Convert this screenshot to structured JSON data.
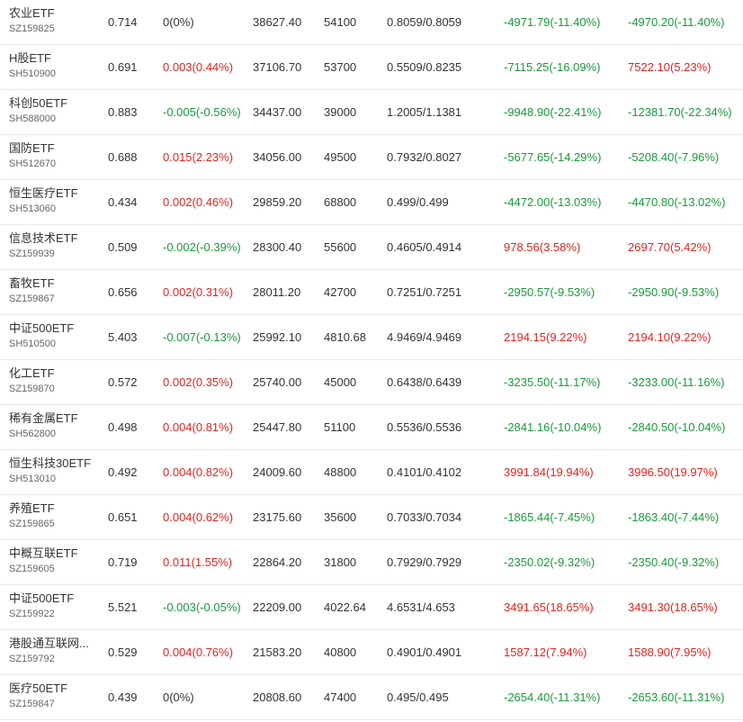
{
  "colors": {
    "up": "#e5231e",
    "down": "#1b9a3c",
    "flat": "#333333"
  },
  "rows": [
    {
      "name": "农业ETF",
      "code": "SZ159825",
      "price": "0.714",
      "change": "0(0%)",
      "change_dir": "flat",
      "amount": "38627.40",
      "volume": "54100",
      "bid_ask": "0.8059/0.8059",
      "premium_a": "-4971.79(-11.40%)",
      "premium_a_dir": "down",
      "premium_b": "-4970.20(-11.40%)",
      "premium_b_dir": "down"
    },
    {
      "name": "H股ETF",
      "code": "SH510900",
      "price": "0.691",
      "change": "0.003(0.44%)",
      "change_dir": "up",
      "amount": "37106.70",
      "volume": "53700",
      "bid_ask": "0.5509/0.8235",
      "premium_a": "-7115.25(-16.09%)",
      "premium_a_dir": "down",
      "premium_b": "7522.10(5.23%)",
      "premium_b_dir": "up"
    },
    {
      "name": "科创50ETF",
      "code": "SH588000",
      "price": "0.883",
      "change": "-0.005(-0.56%)",
      "change_dir": "down",
      "amount": "34437.00",
      "volume": "39000",
      "bid_ask": "1.2005/1.1381",
      "premium_a": "-9948.90(-22.41%)",
      "premium_a_dir": "down",
      "premium_b": "-12381.70(-22.34%)",
      "premium_b_dir": "down"
    },
    {
      "name": "国防ETF",
      "code": "SH512670",
      "price": "0.688",
      "change": "0.015(2.23%)",
      "change_dir": "up",
      "amount": "34056.00",
      "volume": "49500",
      "bid_ask": "0.7932/0.8027",
      "premium_a": "-5677.65(-14.29%)",
      "premium_a_dir": "down",
      "premium_b": "-5208.40(-7.96%)",
      "premium_b_dir": "down"
    },
    {
      "name": "恒生医疗ETF",
      "code": "SH513060",
      "price": "0.434",
      "change": "0.002(0.46%)",
      "change_dir": "up",
      "amount": "29859.20",
      "volume": "68800",
      "bid_ask": "0.499/0.499",
      "premium_a": "-4472.00(-13.03%)",
      "premium_a_dir": "down",
      "premium_b": "-4470.80(-13.02%)",
      "premium_b_dir": "down"
    },
    {
      "name": "信息技术ETF",
      "code": "SZ159939",
      "price": "0.509",
      "change": "-0.002(-0.39%)",
      "change_dir": "down",
      "amount": "28300.40",
      "volume": "55600",
      "bid_ask": "0.4605/0.4914",
      "premium_a": "978.56(3.58%)",
      "premium_a_dir": "up",
      "premium_b": "2697.70(5.42%)",
      "premium_b_dir": "up"
    },
    {
      "name": "畜牧ETF",
      "code": "SZ159867",
      "price": "0.656",
      "change": "0.002(0.31%)",
      "change_dir": "up",
      "amount": "28011.20",
      "volume": "42700",
      "bid_ask": "0.7251/0.7251",
      "premium_a": "-2950.57(-9.53%)",
      "premium_a_dir": "down",
      "premium_b": "-2950.90(-9.53%)",
      "premium_b_dir": "down"
    },
    {
      "name": "中证500ETF",
      "code": "SH510500",
      "price": "5.403",
      "change": "-0.007(-0.13%)",
      "change_dir": "down",
      "amount": "25992.10",
      "volume": "4810.68",
      "bid_ask": "4.9469/4.9469",
      "premium_a": "2194.15(9.22%)",
      "premium_a_dir": "up",
      "premium_b": "2194.10(9.22%)",
      "premium_b_dir": "up"
    },
    {
      "name": "化工ETF",
      "code": "SZ159870",
      "price": "0.572",
      "change": "0.002(0.35%)",
      "change_dir": "up",
      "amount": "25740.00",
      "volume": "45000",
      "bid_ask": "0.6438/0.6439",
      "premium_a": "-3235.50(-11.17%)",
      "premium_a_dir": "down",
      "premium_b": "-3233.00(-11.16%)",
      "premium_b_dir": "down"
    },
    {
      "name": "稀有金属ETF",
      "code": "SH562800",
      "price": "0.498",
      "change": "0.004(0.81%)",
      "change_dir": "up",
      "amount": "25447.80",
      "volume": "51100",
      "bid_ask": "0.5536/0.5536",
      "premium_a": "-2841.16(-10.04%)",
      "premium_a_dir": "down",
      "premium_b": "-2840.50(-10.04%)",
      "premium_b_dir": "down"
    },
    {
      "name": "恒生科技30ETF",
      "code": "SH513010",
      "price": "0.492",
      "change": "0.004(0.82%)",
      "change_dir": "up",
      "amount": "24009.60",
      "volume": "48800",
      "bid_ask": "0.4101/0.4102",
      "premium_a": "3991.84(19.94%)",
      "premium_a_dir": "up",
      "premium_b": "3996.50(19.97%)",
      "premium_b_dir": "up"
    },
    {
      "name": "养殖ETF",
      "code": "SZ159865",
      "price": "0.651",
      "change": "0.004(0.62%)",
      "change_dir": "up",
      "amount": "23175.60",
      "volume": "35600",
      "bid_ask": "0.7033/0.7034",
      "premium_a": "-1865.44(-7.45%)",
      "premium_a_dir": "down",
      "premium_b": "-1863.40(-7.44%)",
      "premium_b_dir": "down"
    },
    {
      "name": "中概互联ETF",
      "code": "SZ159605",
      "price": "0.719",
      "change": "0.011(1.55%)",
      "change_dir": "up",
      "amount": "22864.20",
      "volume": "31800",
      "bid_ask": "0.7929/0.7929",
      "premium_a": "-2350.02(-9.32%)",
      "premium_a_dir": "down",
      "premium_b": "-2350.40(-9.32%)",
      "premium_b_dir": "down"
    },
    {
      "name": "中证500ETF",
      "code": "SZ159922",
      "price": "5.521",
      "change": "-0.003(-0.05%)",
      "change_dir": "down",
      "amount": "22209.00",
      "volume": "4022.64",
      "bid_ask": "4.6531/4.653",
      "premium_a": "3491.65(18.65%)",
      "premium_a_dir": "up",
      "premium_b": "3491.30(18.65%)",
      "premium_b_dir": "up"
    },
    {
      "name": "港股通互联网...",
      "code": "SZ159792",
      "price": "0.529",
      "change": "0.004(0.76%)",
      "change_dir": "up",
      "amount": "21583.20",
      "volume": "40800",
      "bid_ask": "0.4901/0.4901",
      "premium_a": "1587.12(7.94%)",
      "premium_a_dir": "up",
      "premium_b": "1588.90(7.95%)",
      "premium_b_dir": "up"
    },
    {
      "name": "医疗50ETF",
      "code": "SZ159847",
      "price": "0.439",
      "change": "0(0%)",
      "change_dir": "flat",
      "amount": "20808.60",
      "volume": "47400",
      "bid_ask": "0.495/0.495",
      "premium_a": "-2654.40(-11.31%)",
      "premium_a_dir": "down",
      "premium_b": "-2653.60(-11.31%)",
      "premium_b_dir": "down"
    }
  ]
}
